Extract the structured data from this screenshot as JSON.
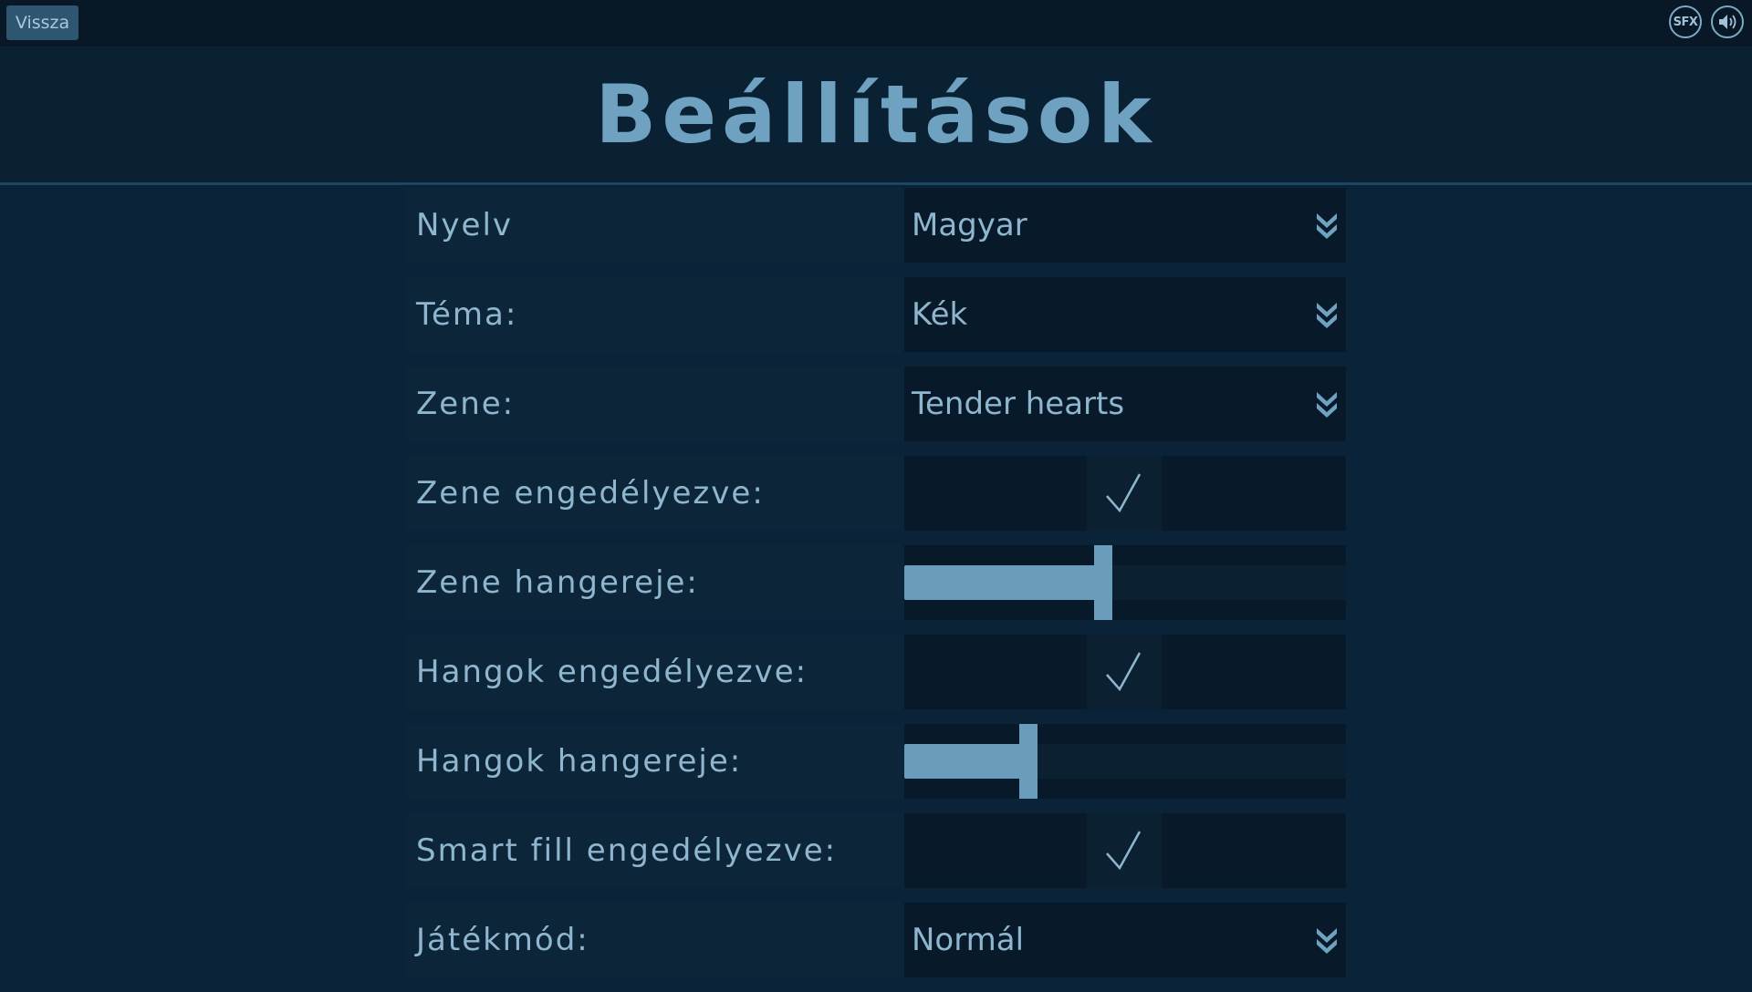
{
  "topbar": {
    "back_label": "Vissza",
    "sfx_label": "SFX",
    "sound_icon": "speaker-icon"
  },
  "page": {
    "title": "Beállítások"
  },
  "settings": {
    "language": {
      "label": "Nyelv",
      "value": "Magyar"
    },
    "theme": {
      "label": "Téma:",
      "value": "Kék"
    },
    "music": {
      "label": "Zene:",
      "value": "Tender hearts"
    },
    "music_enabled": {
      "label": "Zene engedélyezve:",
      "checked": true
    },
    "music_volume": {
      "label": "Zene hangereje:",
      "level": 0.45
    },
    "sounds_enabled": {
      "label": "Hangok engedélyezve:",
      "checked": true
    },
    "sounds_volume": {
      "label": "Hangok hangereje:",
      "level": 0.28
    },
    "smart_fill_enabled": {
      "label": "Smart fill engedélyezve:",
      "checked": true
    },
    "game_mode": {
      "label": "Játékmód:",
      "value": "Normál"
    }
  },
  "colors": {
    "background": "#0b2338",
    "accent": "#6a9dbc",
    "text": "#8fb6cf"
  }
}
